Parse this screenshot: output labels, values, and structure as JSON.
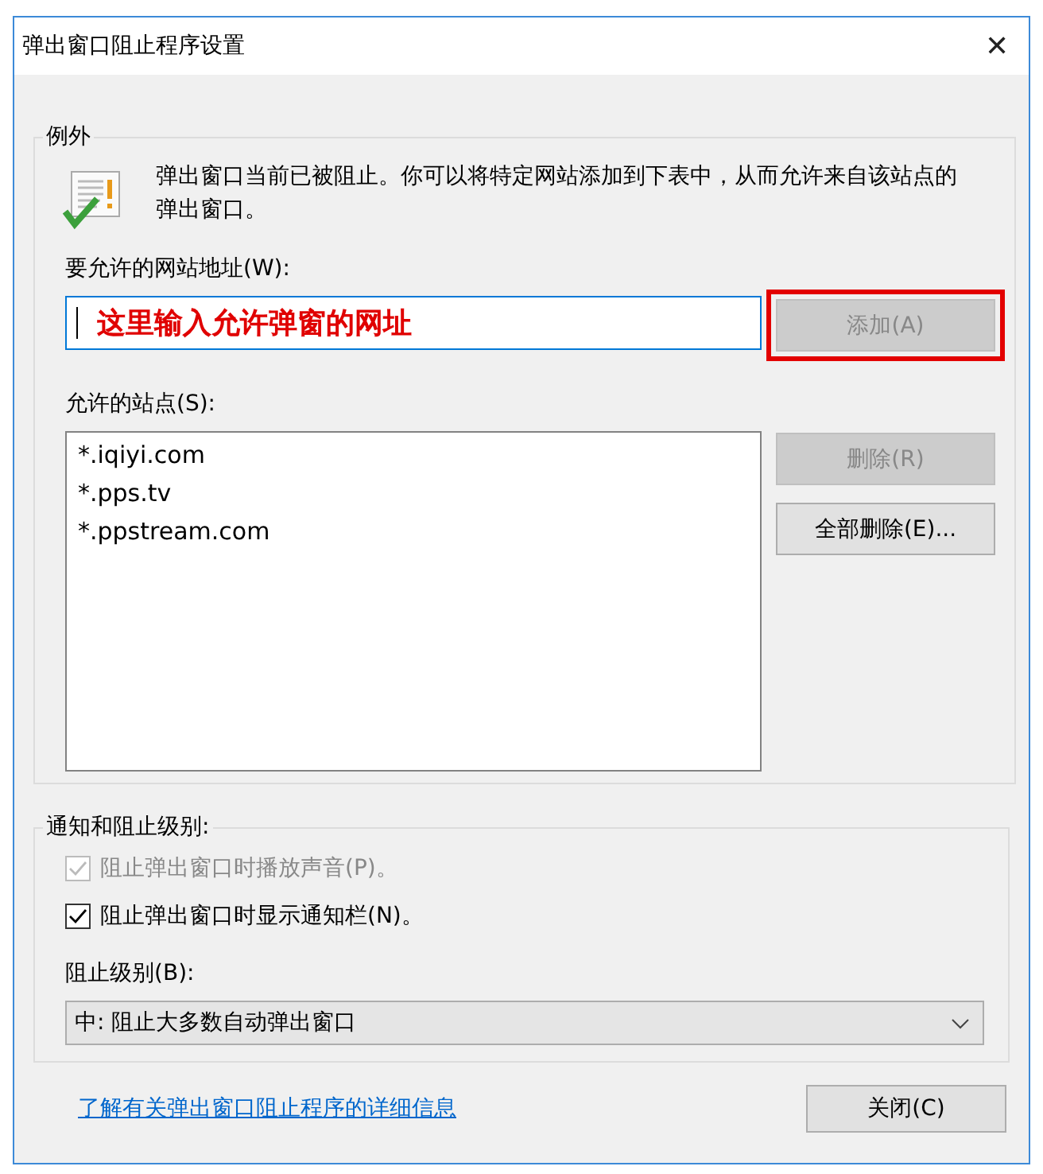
{
  "window": {
    "title": "弹出窗口阻止程序设置",
    "close": "✕"
  },
  "exceptions": {
    "legend": "例外",
    "description": "弹出窗口当前已被阻止。你可以将特定网站添加到下表中，从而允许来自该站点的弹出窗口。",
    "address_label": "要允许的网站地址(W):",
    "annotation": "这里输入允许弹窗的网址",
    "add_button": {
      "label": "添加(A)",
      "disabled": true,
      "highlighted": true
    },
    "sites_label": "允许的站点(S):",
    "sites": [
      "*.iqiyi.com",
      "*.pps.tv",
      "*.ppstream.com"
    ],
    "remove_button": {
      "label": "删除(R)",
      "disabled": true
    },
    "remove_all_button": {
      "label": "全部删除(E)...",
      "disabled": false
    }
  },
  "notifications": {
    "legend": "通知和阻止级别:",
    "options": [
      {
        "label": "阻止弹出窗口时播放声音(P)。",
        "checked": true,
        "disabled": true
      },
      {
        "label": "阻止弹出窗口时显示通知栏(N)。",
        "checked": true,
        "disabled": false
      }
    ],
    "level_label": "阻止级别(B):",
    "level_value": "中: 阻止大多数自动弹出窗口"
  },
  "footer": {
    "link": "了解有关弹出窗口阻止程序的详细信息",
    "close_button": "关闭(C)"
  }
}
